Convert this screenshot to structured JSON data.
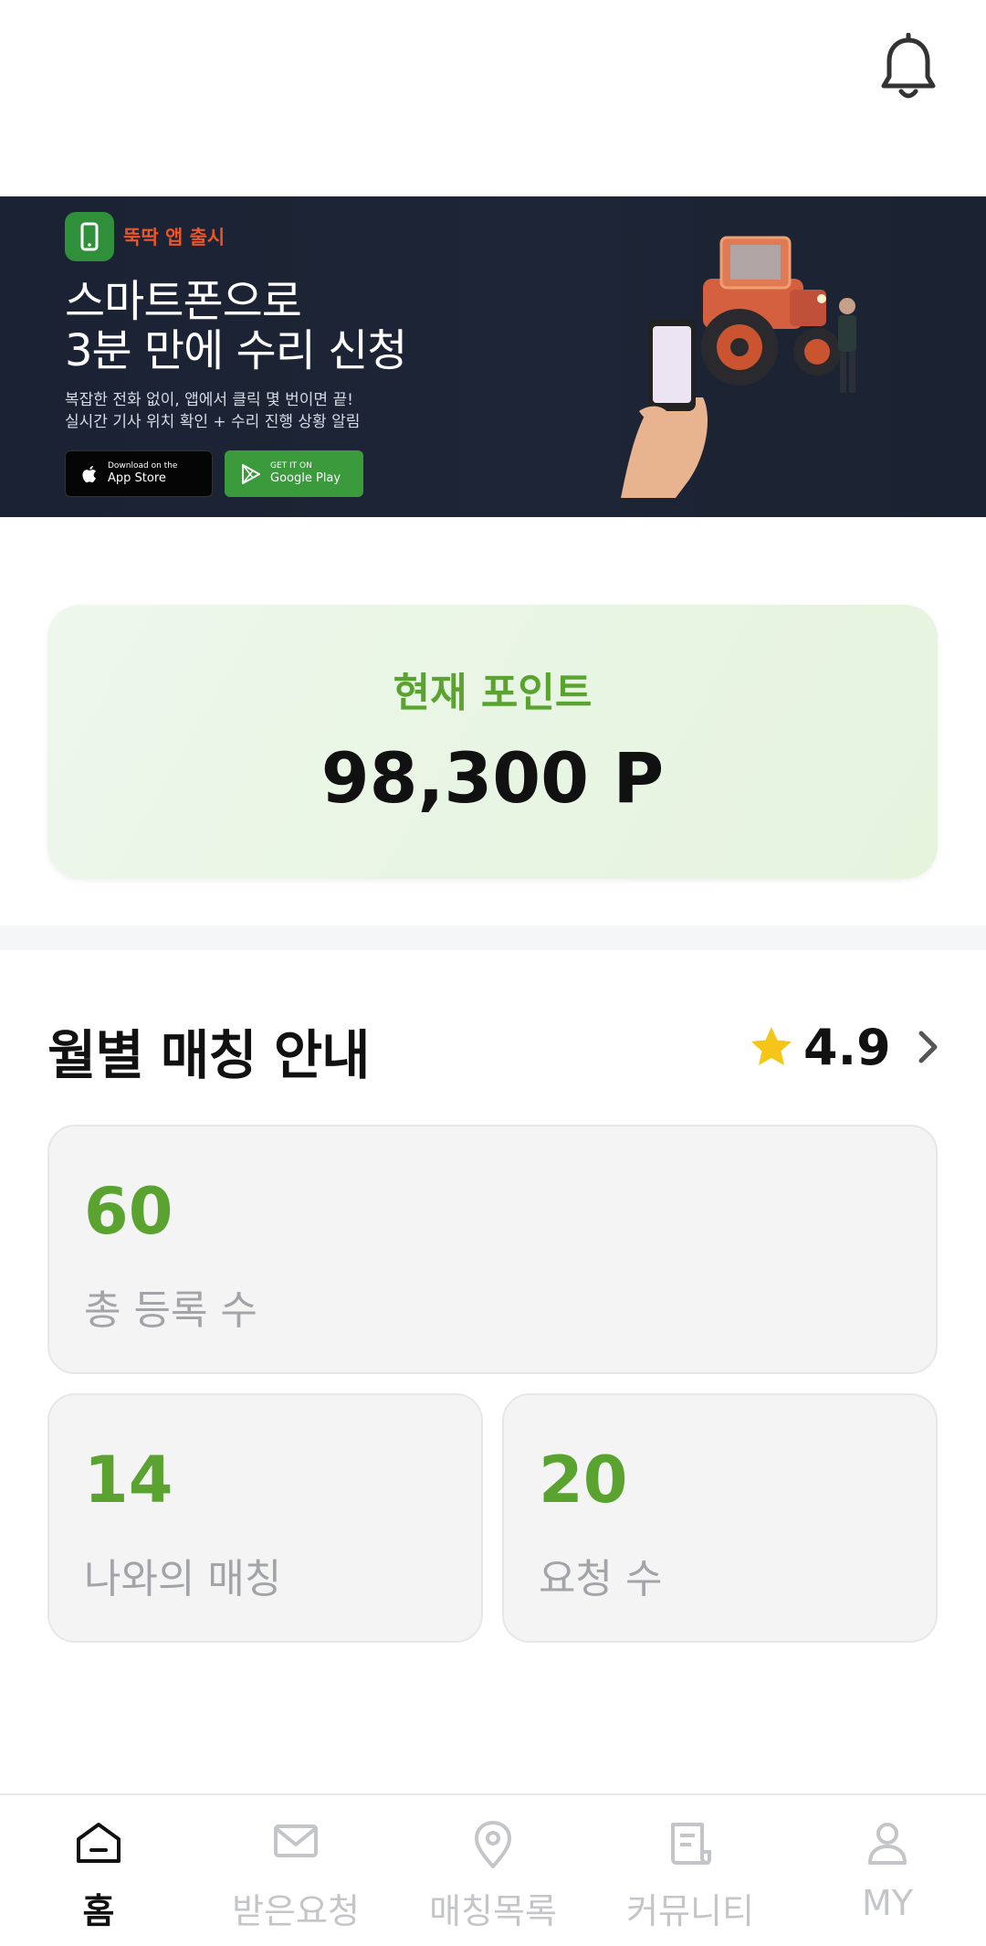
{
  "header": {
    "icon": "bell-icon"
  },
  "banner": {
    "badge": "뚝딱 앱 출시",
    "title_line1": "스마트폰으로",
    "title_line2": "3분 만에 수리 신청",
    "desc_line1": "복잡한 전화 없이, 앱에서 클릭 몇 번이면 끝!",
    "desc_line2": "실시간 기사 위치 확인 + 수리 진행 상황 알림",
    "appstore_small": "Download on the",
    "appstore_big": "App Store",
    "googleplay_small": "GET IT ON",
    "googleplay_big": "Google Play"
  },
  "points": {
    "label": "현재 포인트",
    "value": "98,300 P"
  },
  "matching": {
    "title": "월별 매칭 안내",
    "rating": "4.9",
    "total": {
      "value": "60",
      "label": "총 등록 수"
    },
    "mine": {
      "value": "14",
      "label": "나와의 매칭"
    },
    "requests": {
      "value": "20",
      "label": "요청 수"
    }
  },
  "nav": {
    "items": [
      {
        "label": "홈",
        "icon": "home-icon",
        "active": true
      },
      {
        "label": "받은요청",
        "icon": "mail-icon",
        "active": false
      },
      {
        "label": "매칭목록",
        "icon": "location-pin-icon",
        "active": false
      },
      {
        "label": "커뮤니티",
        "icon": "document-icon",
        "active": false
      },
      {
        "label": "MY",
        "icon": "user-icon",
        "active": false
      }
    ]
  },
  "colors": {
    "accent_green": "#5aa331",
    "banner_bg": "#1a2233",
    "badge_orange": "#e8572a"
  }
}
